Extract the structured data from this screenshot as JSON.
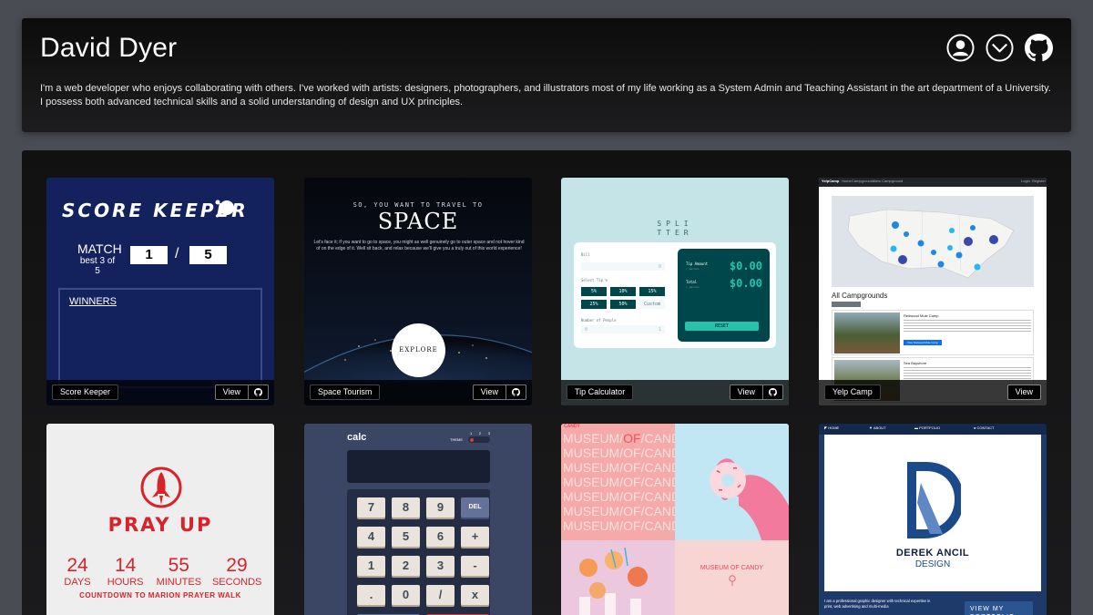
{
  "header": {
    "name": "David Dyer",
    "bio": "I'm a web developer who enjoys collaborating with others. I've worked with artists: designers, photographers, and illustrators most of my life working as a System Admin and Teaching Assistant in the art department of a University. I possess both advanced technical skills and a solid understanding of design and UX principles.",
    "icons": [
      "user-icon",
      "email-icon",
      "github-icon"
    ]
  },
  "cards": [
    {
      "label": "Score Keeper",
      "view": "View"
    },
    {
      "label": "Space Tourism",
      "view": "View"
    },
    {
      "label": "Tip Calculator",
      "view": "View"
    },
    {
      "label": "Yelp Camp",
      "view": "View"
    }
  ],
  "score": {
    "title": "SCORE KEEPER",
    "match": "MATCH",
    "best": "best 3 of 5",
    "p1": "1",
    "sep": "/",
    "p2": "5",
    "winners": "WINNERS"
  },
  "space": {
    "pre": "SO, YOU WANT TO TRAVEL TO",
    "title": "SPACE",
    "body": "Let's face it; if you want to go to space, you might as well genuinely go to outer space and not hover kind of on the edge of it. Well sit back, and relax because we'll give you a truly out of this world experience!",
    "explore": "EXPLORE"
  },
  "tip": {
    "logo1": "SPLI",
    "logo2": "TTER",
    "bill": "Bill",
    "bill_val": "0",
    "select": "Select Tip %",
    "tips": [
      "5%",
      "10%",
      "15%",
      "25%",
      "50%",
      "Custom"
    ],
    "people": "Number of People",
    "people_val": "1",
    "tip_amount": "Tip Amount",
    "per_person": "/ person",
    "total": "Total",
    "amt1": "$0.00",
    "amt2": "$0.00",
    "reset": "RESET"
  },
  "yelp": {
    "brand": "YelpCamp",
    "nav": [
      "Home",
      "Campgrounds",
      "New Campground"
    ],
    "login": "Login",
    "register": "Register",
    "heading": "All Campgrounds",
    "camp1": "Redwood Mule Camp",
    "camp2": "Sea Bayshore",
    "view_btn": "View Redwood Mule Camp"
  },
  "pray": {
    "title": "PRAY UP",
    "nums": [
      "24",
      "14",
      "55",
      "29"
    ],
    "units": [
      "DAYS",
      "HOURS",
      "MINUTES",
      "SECONDS"
    ],
    "caption": "COUNTDOWN TO MARION PRAYER WALK"
  },
  "calc": {
    "title": "calc",
    "theme": "THEME",
    "theme_nums": [
      "1",
      "2",
      "3"
    ],
    "keys": [
      "7",
      "8",
      "9",
      "DEL",
      "4",
      "5",
      "6",
      "+",
      "1",
      "2",
      "3",
      "-",
      ".",
      "0",
      "/",
      "x"
    ]
  },
  "candy": {
    "tag": "CANDY",
    "words": [
      "MUSEUM",
      "OF",
      "CANDY"
    ],
    "caption": "MUSEUM OF CANDY"
  },
  "derek": {
    "nav": [
      "HOME",
      "ABOUT",
      "PORTFOLIO",
      "CONTACT"
    ],
    "name": "DEREK ANCIL",
    "design": "DESIGN",
    "about": "I am a professional graphic designer with technical expertise in print, web advertising and multi-media",
    "view": "VIEW MY PORTFOLIO"
  },
  "colors": {
    "score_bg": "#13225d",
    "tip_bg": "#c5e4e7",
    "tip_dark": "#00474b",
    "tip_accent": "#26c2ae",
    "pray_red": "#d8232a",
    "calc_bg": "#3a4663",
    "candy_pink": "#f7c5c7",
    "candy_blue": "#c1e7f4",
    "derek_blue": "#1b4a8a"
  }
}
